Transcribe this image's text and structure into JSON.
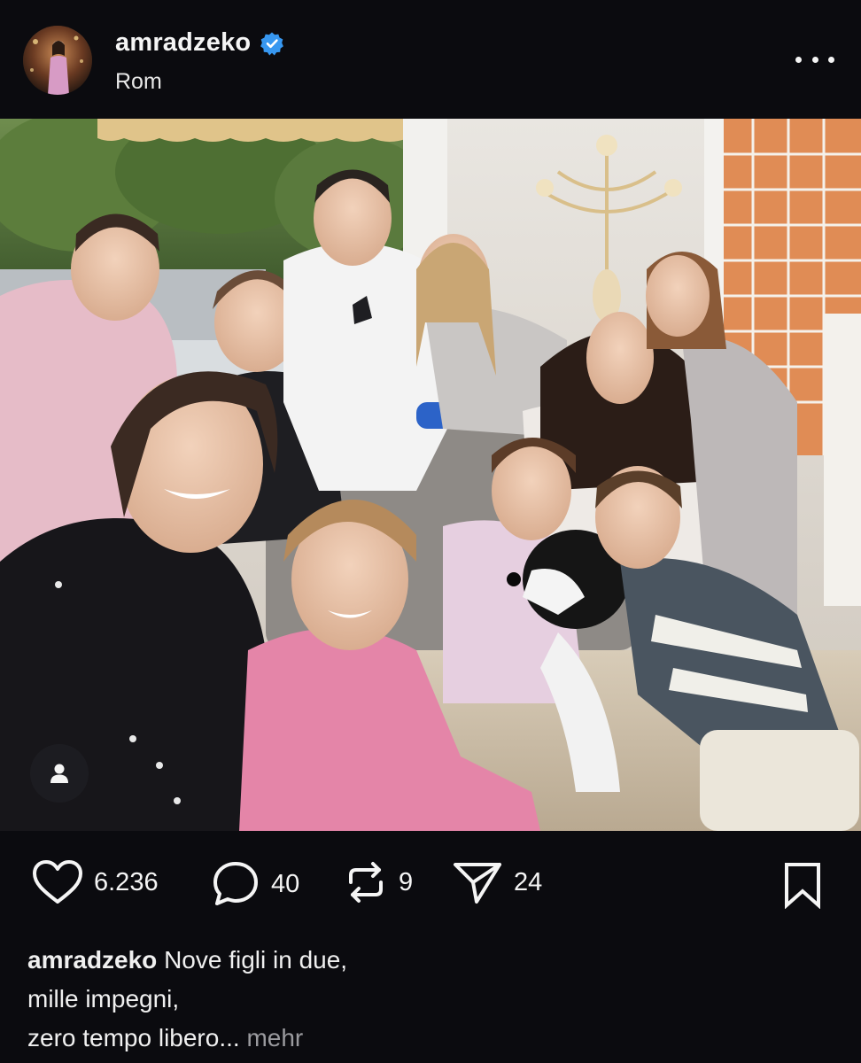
{
  "post": {
    "username": "amradzeko",
    "location": "Rom",
    "verified": true
  },
  "actions": {
    "likes": "6.236",
    "comments": "40",
    "reposts": "9",
    "shares": "24"
  },
  "caption": {
    "username": "amradzeko",
    "line1": "Nove figli in due,",
    "line2": "mille impegni,",
    "line3": "zero tempo libero...",
    "more_label": "mehr"
  },
  "icons": {
    "verified": "verified-badge-icon",
    "more": "more-options-icon",
    "tag": "user-tag-icon",
    "like": "heart-icon",
    "comment": "comment-bubble-icon",
    "repost": "repost-icon",
    "share": "send-icon",
    "save": "bookmark-icon"
  },
  "colors": {
    "background": "#0b0b0f",
    "verified": "#3797f0",
    "muted": "#9a9a9e"
  }
}
